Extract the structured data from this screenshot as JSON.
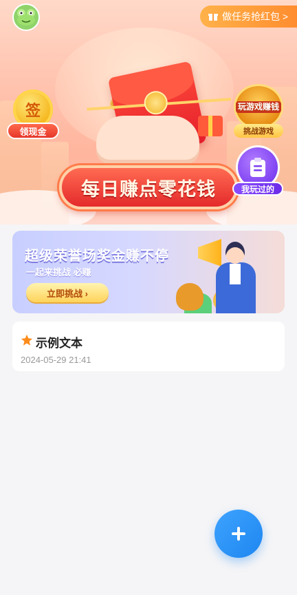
{
  "header": {
    "avatar_icon": "frog-avatar-icon",
    "task_button_label": "做任务抢红包 >"
  },
  "hero": {
    "sign_coin_text": "签",
    "sign_label": "领现金",
    "game_badge_text": "玩游戏赚钱",
    "game_label": "挑战游戏",
    "banner_title": "每日赚点零花钱",
    "played_label": "我玩过的"
  },
  "promo": {
    "title": "超级荣誉场奖金赚不停",
    "subtitle": "一起来挑战 必赚",
    "cta_label": "立即挑战 ›"
  },
  "card": {
    "name": "示例文本",
    "time": "2024-05-29 21:41",
    "star_color": "#ff8c1a"
  },
  "fab": {
    "icon": "plus-icon"
  },
  "colors": {
    "accent": "#1e86f0",
    "background": "#f5f5f7",
    "hero_red": "#e42a2b"
  }
}
